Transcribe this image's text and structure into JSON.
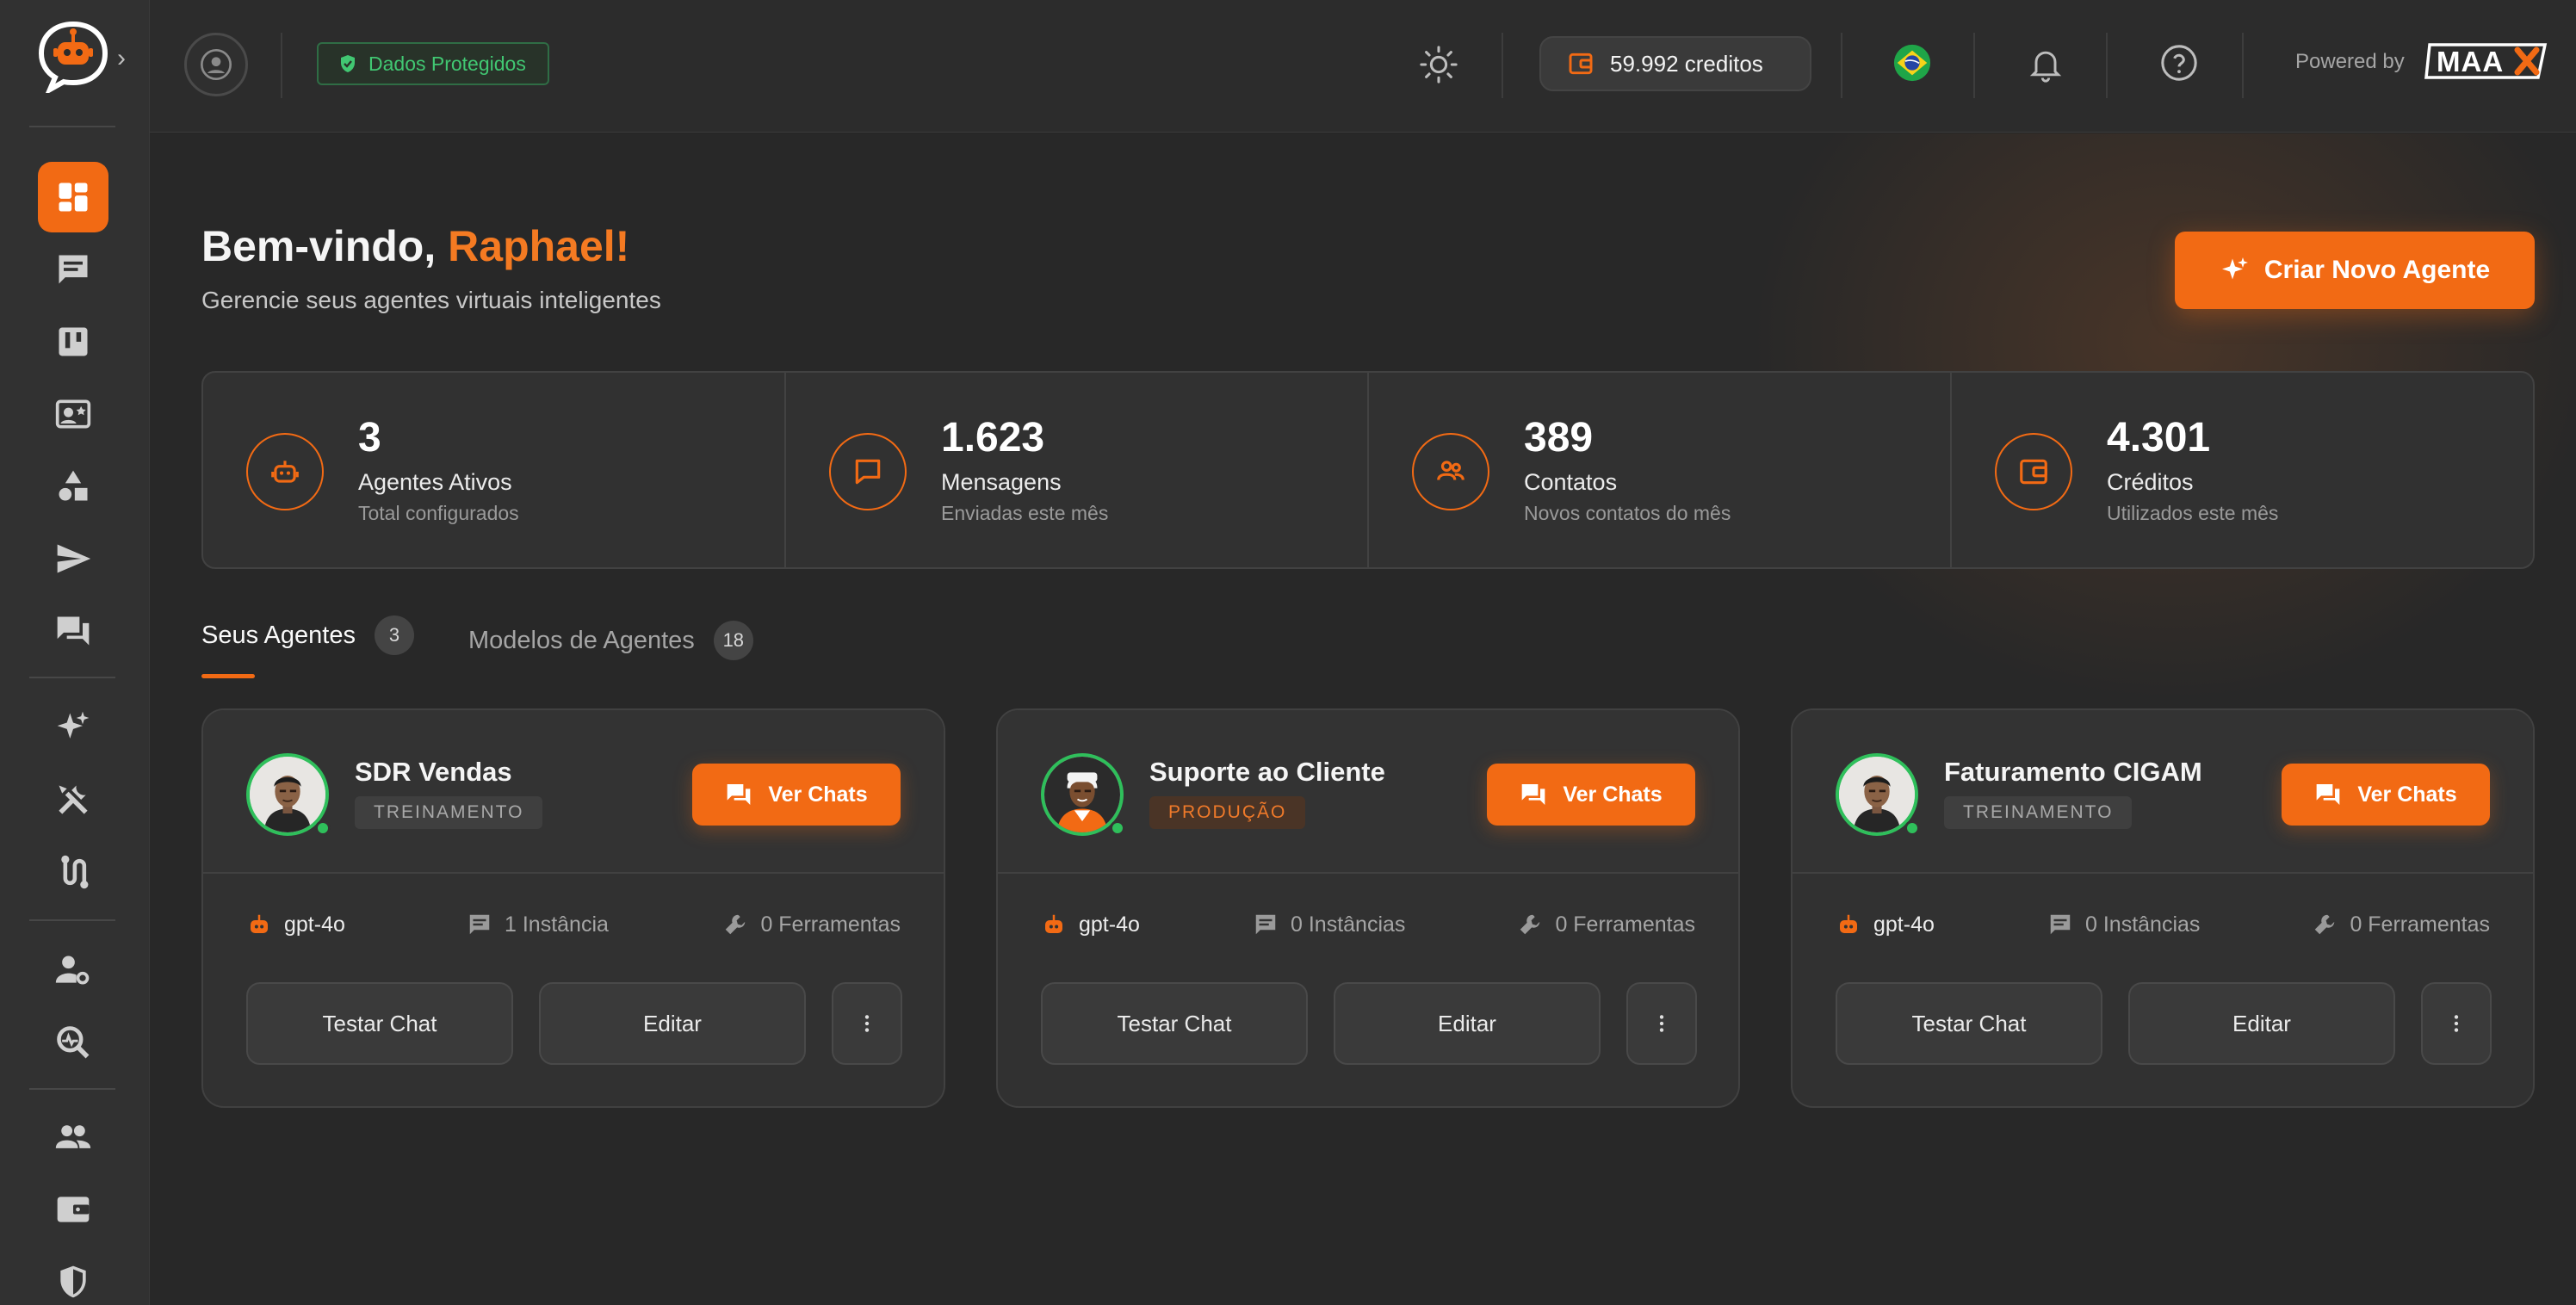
{
  "colors": {
    "accent": "#f26a14",
    "success": "#2fbf5b",
    "background": "#282828"
  },
  "topbar": {
    "protected_label": "Dados Protegidos",
    "credits_label": "59.992 creditos",
    "powered_by": "Powered by",
    "brand": "MAAX"
  },
  "header": {
    "greeting": "Bem-vindo,",
    "user_name": "Raphael!",
    "subtitle": "Gerencie seus agentes virtuais inteligentes",
    "create_button": "Criar Novo Agente"
  },
  "stats": [
    {
      "value": "3",
      "label": "Agentes Ativos",
      "sub": "Total configurados",
      "icon": "robot-icon"
    },
    {
      "value": "1.623",
      "label": "Mensagens",
      "sub": "Enviadas este mês",
      "icon": "message-icon"
    },
    {
      "value": "389",
      "label": "Contatos",
      "sub": "Novos contatos do mês",
      "icon": "users-icon"
    },
    {
      "value": "4.301",
      "label": "Créditos",
      "sub": "Utilizados este mês",
      "icon": "wallet-icon"
    }
  ],
  "tabs": [
    {
      "label": "Seus Agentes",
      "count": "3",
      "active": true
    },
    {
      "label": "Modelos de Agentes",
      "count": "18",
      "active": false
    }
  ],
  "agents": [
    {
      "name": "SDR Vendas",
      "status": "TREINAMENTO",
      "model": "gpt-4o",
      "instances": "1 Instância",
      "tools": "0 Ferramentas",
      "view_chats": "Ver Chats",
      "test_chat": "Testar Chat",
      "edit": "Editar"
    },
    {
      "name": "Suporte ao Cliente",
      "status": "PRODUÇÃO",
      "model": "gpt-4o",
      "instances": "0 Instâncias",
      "tools": "0 Ferramentas",
      "view_chats": "Ver Chats",
      "test_chat": "Testar Chat",
      "edit": "Editar"
    },
    {
      "name": "Faturamento CIGAM",
      "status": "TREINAMENTO",
      "model": "gpt-4o",
      "instances": "0 Instâncias",
      "tools": "0 Ferramentas",
      "view_chats": "Ver Chats",
      "test_chat": "Testar Chat",
      "edit": "Editar"
    }
  ],
  "sidebar": {
    "items": [
      "dashboard-icon",
      "chat-icon",
      "kanban-icon",
      "contact-card-icon",
      "shapes-icon",
      "send-icon",
      "forum-icon",
      "sparkles-icon",
      "tools-icon",
      "flow-icon",
      "user-settings-icon",
      "analytics-icon",
      "team-icon",
      "wallet-icon",
      "shield-icon"
    ]
  }
}
